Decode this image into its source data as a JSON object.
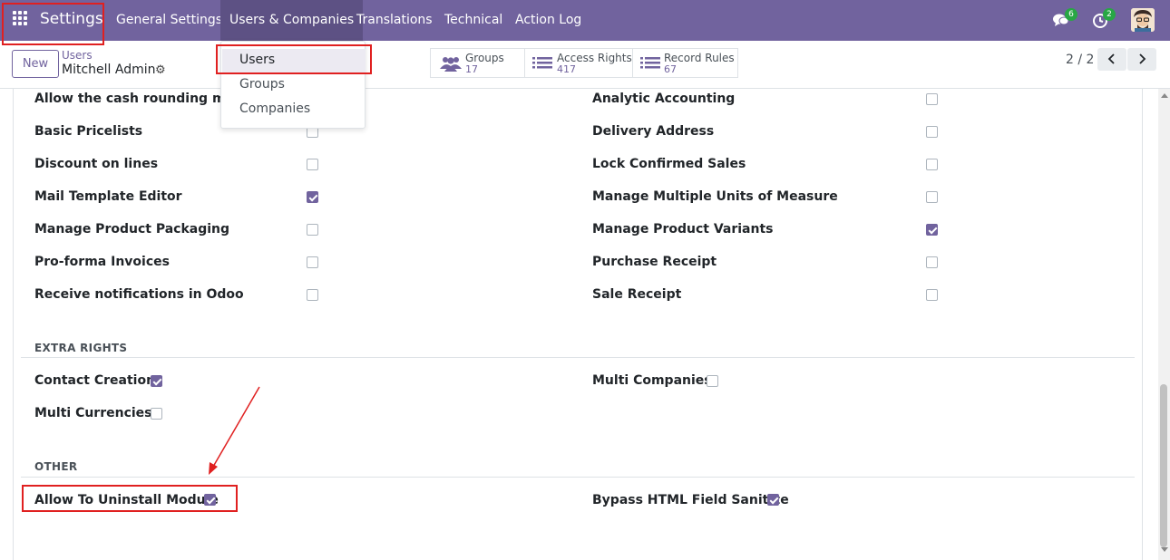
{
  "navbar": {
    "app_title": "Settings",
    "menus": [
      {
        "label": "General Settings"
      },
      {
        "label": "Users & Companies"
      },
      {
        "label": "Translations"
      },
      {
        "label": "Technical"
      },
      {
        "label": "Action Log"
      }
    ],
    "messages_badge": "6",
    "activities_badge": "2",
    "colors": {
      "brand": "#71639e",
      "badge": "#28a745"
    }
  },
  "dropdown": {
    "items": [
      {
        "label": "Users"
      },
      {
        "label": "Groups"
      },
      {
        "label": "Companies"
      }
    ]
  },
  "control_panel": {
    "new_label": "New",
    "breadcrumb_parent": "Users",
    "breadcrumb_current": "Mitchell Admin",
    "smart_buttons": [
      {
        "label": "Groups",
        "count": "17",
        "icon": "users-icon"
      },
      {
        "label": "Access Rights",
        "count": "417",
        "icon": "list-icon"
      },
      {
        "label": "Record Rules",
        "count": "67",
        "icon": "list-icon"
      }
    ],
    "pager": "2 / 2"
  },
  "rights": {
    "left": [
      {
        "label": "Allow the cash rounding manage",
        "checked": null
      },
      {
        "label": "Basic Pricelists",
        "checked": false
      },
      {
        "label": "Discount on lines",
        "checked": false
      },
      {
        "label": "Mail Template Editor",
        "checked": true
      },
      {
        "label": "Manage Product Packaging",
        "checked": false
      },
      {
        "label": "Pro-forma Invoices",
        "checked": false
      },
      {
        "label": "Receive notifications in Odoo",
        "checked": false
      }
    ],
    "right": [
      {
        "label": "Analytic Accounting",
        "checked": false
      },
      {
        "label": "Delivery Address",
        "checked": false
      },
      {
        "label": "Lock Confirmed Sales",
        "checked": false
      },
      {
        "label": "Manage Multiple Units of Measure",
        "checked": false
      },
      {
        "label": "Manage Product Variants",
        "checked": true
      },
      {
        "label": "Purchase Receipt",
        "checked": false
      },
      {
        "label": "Sale Receipt",
        "checked": false
      }
    ]
  },
  "extra_rights": {
    "title": "EXTRA RIGHTS",
    "items": [
      {
        "label": "Contact Creation",
        "checked": true
      },
      {
        "label": "Multi Companies",
        "checked": false
      },
      {
        "label": "Multi Currencies",
        "checked": false
      }
    ]
  },
  "other": {
    "title": "OTHER",
    "items": [
      {
        "label": "Allow To Uninstall Module",
        "checked": true
      },
      {
        "label": "Bypass HTML Field Sanitize",
        "checked": true
      }
    ]
  }
}
